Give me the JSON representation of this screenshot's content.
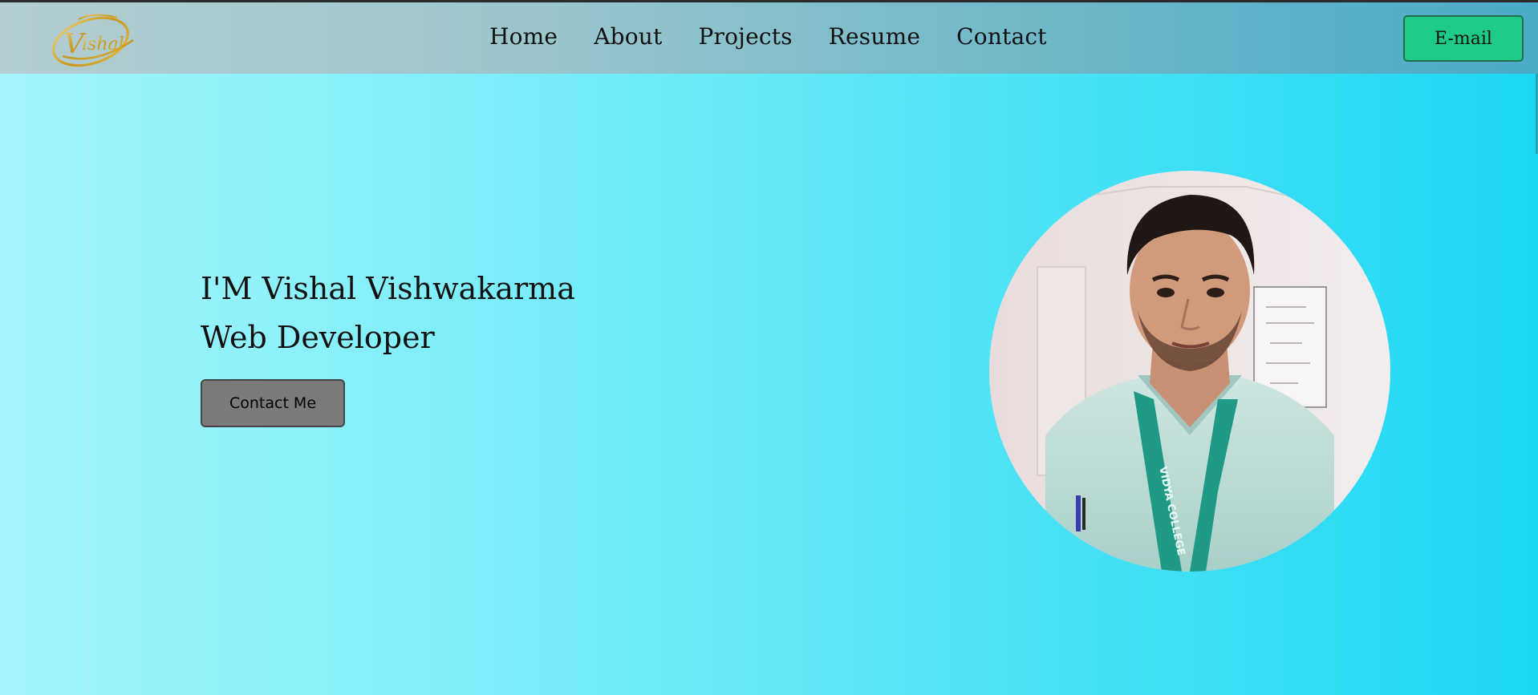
{
  "brand": {
    "logo_text": "Vishal",
    "logo_color": "#c9961a"
  },
  "nav": {
    "items": [
      {
        "label": "Home"
      },
      {
        "label": "About"
      },
      {
        "label": "Projects"
      },
      {
        "label": "Resume"
      },
      {
        "label": "Contact"
      }
    ],
    "email_label": "E-mail",
    "email_color": "#1ecb86"
  },
  "hero": {
    "line1": "I'M Vishal Vishwakarma",
    "line2": "Web Developer",
    "cta_label": "Contact Me",
    "cta_color": "#7b7b7b"
  },
  "photo": {
    "badge_text": "VIDYA COLLEGE"
  }
}
